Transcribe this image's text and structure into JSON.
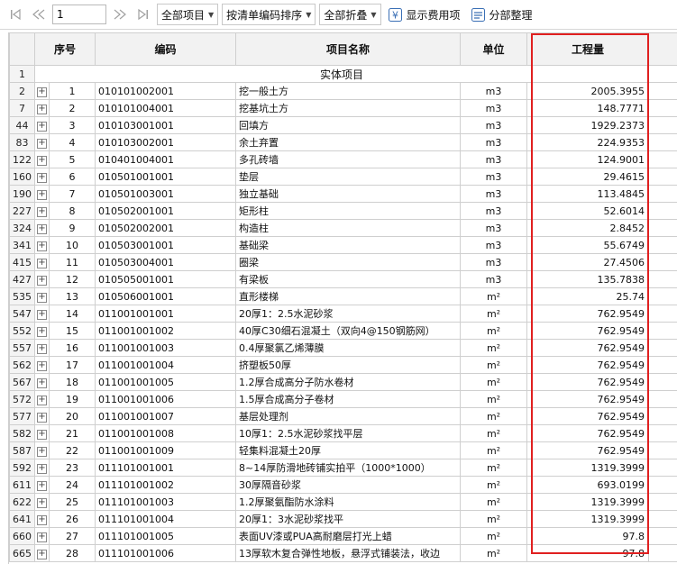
{
  "toolbar": {
    "page_value": "1",
    "dropdowns": [
      "全部项目",
      "按清单编码排序",
      "全部折叠"
    ],
    "show_fee_label": "显示费用项",
    "organize_label": "分部整理"
  },
  "table": {
    "headers": {
      "seq": "序号",
      "code": "编码",
      "name": "项目名称",
      "unit": "单位",
      "quantity": "工程量"
    },
    "group_row": {
      "row_no": "1",
      "label": "实体项目"
    },
    "rows": [
      {
        "row_no": "2",
        "seq": "1",
        "code": "010101002001",
        "name": "挖一般土方",
        "unit": "m3",
        "qty": "2005.3955"
      },
      {
        "row_no": "7",
        "seq": "2",
        "code": "010101004001",
        "name": "挖基坑土方",
        "unit": "m3",
        "qty": "148.7771"
      },
      {
        "row_no": "44",
        "seq": "3",
        "code": "010103001001",
        "name": "回填方",
        "unit": "m3",
        "qty": "1929.2373"
      },
      {
        "row_no": "83",
        "seq": "4",
        "code": "010103002001",
        "name": "余土弃置",
        "unit": "m3",
        "qty": "224.9353"
      },
      {
        "row_no": "122",
        "seq": "5",
        "code": "010401004001",
        "name": "多孔砖墙",
        "unit": "m3",
        "qty": "124.9001"
      },
      {
        "row_no": "160",
        "seq": "6",
        "code": "010501001001",
        "name": "垫层",
        "unit": "m3",
        "qty": "29.4615"
      },
      {
        "row_no": "190",
        "seq": "7",
        "code": "010501003001",
        "name": "独立基础",
        "unit": "m3",
        "qty": "113.4845"
      },
      {
        "row_no": "227",
        "seq": "8",
        "code": "010502001001",
        "name": "矩形柱",
        "unit": "m3",
        "qty": "52.6014"
      },
      {
        "row_no": "324",
        "seq": "9",
        "code": "010502002001",
        "name": "构造柱",
        "unit": "m3",
        "qty": "2.8452"
      },
      {
        "row_no": "341",
        "seq": "10",
        "code": "010503001001",
        "name": "基础梁",
        "unit": "m3",
        "qty": "55.6749"
      },
      {
        "row_no": "415",
        "seq": "11",
        "code": "010503004001",
        "name": "圈梁",
        "unit": "m3",
        "qty": "27.4506"
      },
      {
        "row_no": "427",
        "seq": "12",
        "code": "010505001001",
        "name": "有梁板",
        "unit": "m3",
        "qty": "135.7838"
      },
      {
        "row_no": "535",
        "seq": "13",
        "code": "010506001001",
        "name": "直形楼梯",
        "unit": "m²",
        "qty": "25.74"
      },
      {
        "row_no": "547",
        "seq": "14",
        "code": "011001001001",
        "name": "20厚1：2.5水泥砂浆",
        "unit": "m²",
        "qty": "762.9549"
      },
      {
        "row_no": "552",
        "seq": "15",
        "code": "011001001002",
        "name": "40厚C30细石混凝土（双向4@150钢筋网）",
        "unit": "m²",
        "qty": "762.9549"
      },
      {
        "row_no": "557",
        "seq": "16",
        "code": "011001001003",
        "name": "0.4厚聚氯乙烯薄膜",
        "unit": "m²",
        "qty": "762.9549"
      },
      {
        "row_no": "562",
        "seq": "17",
        "code": "011001001004",
        "name": "挤塑板50厚",
        "unit": "m²",
        "qty": "762.9549"
      },
      {
        "row_no": "567",
        "seq": "18",
        "code": "011001001005",
        "name": "1.2厚合成高分子防水卷材",
        "unit": "m²",
        "qty": "762.9549"
      },
      {
        "row_no": "572",
        "seq": "19",
        "code": "011001001006",
        "name": "1.5厚合成高分子卷材",
        "unit": "m²",
        "qty": "762.9549"
      },
      {
        "row_no": "577",
        "seq": "20",
        "code": "011001001007",
        "name": "基层处理剂",
        "unit": "m²",
        "qty": "762.9549"
      },
      {
        "row_no": "582",
        "seq": "21",
        "code": "011001001008",
        "name": "10厚1：2.5水泥砂浆找平层",
        "unit": "m²",
        "qty": "762.9549"
      },
      {
        "row_no": "587",
        "seq": "22",
        "code": "011001001009",
        "name": "轻集料混凝土20厚",
        "unit": "m²",
        "qty": "762.9549"
      },
      {
        "row_no": "592",
        "seq": "23",
        "code": "011101001001",
        "name": "8~14厚防滑地砖铺实拍平（1000*1000）",
        "unit": "m²",
        "qty": "1319.3999"
      },
      {
        "row_no": "611",
        "seq": "24",
        "code": "011101001002",
        "name": "30厚隔音砂浆",
        "unit": "m²",
        "qty": "693.0199"
      },
      {
        "row_no": "622",
        "seq": "25",
        "code": "011101001003",
        "name": "1.2厚聚氨酯防水涂料",
        "unit": "m²",
        "qty": "1319.3999"
      },
      {
        "row_no": "641",
        "seq": "26",
        "code": "011101001004",
        "name": "20厚1：3水泥砂浆找平",
        "unit": "m²",
        "qty": "1319.3999"
      },
      {
        "row_no": "660",
        "seq": "27",
        "code": "011101001005",
        "name": "表面UV漆或PUA高耐磨层打光上蜡",
        "unit": "m²",
        "qty": "97.8"
      },
      {
        "row_no": "665",
        "seq": "28",
        "code": "011101001006",
        "name": "13厚软木复合弹性地板，悬浮式铺装法，收边",
        "unit": "m²",
        "qty": "97.8"
      }
    ]
  },
  "highlight": {
    "color": "#e02020"
  }
}
